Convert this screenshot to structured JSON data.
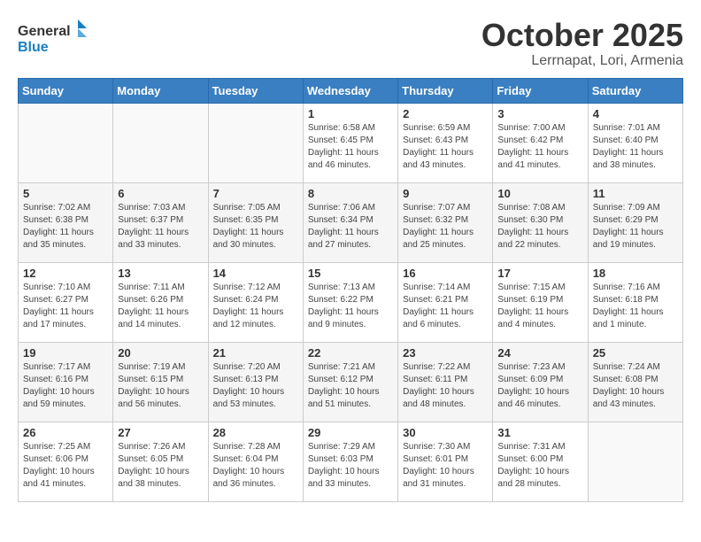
{
  "header": {
    "logo_line1": "General",
    "logo_line2": "Blue",
    "month": "October 2025",
    "location": "Lerrnapat, Lori, Armenia"
  },
  "days_of_week": [
    "Sunday",
    "Monday",
    "Tuesday",
    "Wednesday",
    "Thursday",
    "Friday",
    "Saturday"
  ],
  "weeks": [
    [
      {
        "day": "",
        "info": ""
      },
      {
        "day": "",
        "info": ""
      },
      {
        "day": "",
        "info": ""
      },
      {
        "day": "1",
        "info": "Sunrise: 6:58 AM\nSunset: 6:45 PM\nDaylight: 11 hours\nand 46 minutes."
      },
      {
        "day": "2",
        "info": "Sunrise: 6:59 AM\nSunset: 6:43 PM\nDaylight: 11 hours\nand 43 minutes."
      },
      {
        "day": "3",
        "info": "Sunrise: 7:00 AM\nSunset: 6:42 PM\nDaylight: 11 hours\nand 41 minutes."
      },
      {
        "day": "4",
        "info": "Sunrise: 7:01 AM\nSunset: 6:40 PM\nDaylight: 11 hours\nand 38 minutes."
      }
    ],
    [
      {
        "day": "5",
        "info": "Sunrise: 7:02 AM\nSunset: 6:38 PM\nDaylight: 11 hours\nand 35 minutes."
      },
      {
        "day": "6",
        "info": "Sunrise: 7:03 AM\nSunset: 6:37 PM\nDaylight: 11 hours\nand 33 minutes."
      },
      {
        "day": "7",
        "info": "Sunrise: 7:05 AM\nSunset: 6:35 PM\nDaylight: 11 hours\nand 30 minutes."
      },
      {
        "day": "8",
        "info": "Sunrise: 7:06 AM\nSunset: 6:34 PM\nDaylight: 11 hours\nand 27 minutes."
      },
      {
        "day": "9",
        "info": "Sunrise: 7:07 AM\nSunset: 6:32 PM\nDaylight: 11 hours\nand 25 minutes."
      },
      {
        "day": "10",
        "info": "Sunrise: 7:08 AM\nSunset: 6:30 PM\nDaylight: 11 hours\nand 22 minutes."
      },
      {
        "day": "11",
        "info": "Sunrise: 7:09 AM\nSunset: 6:29 PM\nDaylight: 11 hours\nand 19 minutes."
      }
    ],
    [
      {
        "day": "12",
        "info": "Sunrise: 7:10 AM\nSunset: 6:27 PM\nDaylight: 11 hours\nand 17 minutes."
      },
      {
        "day": "13",
        "info": "Sunrise: 7:11 AM\nSunset: 6:26 PM\nDaylight: 11 hours\nand 14 minutes."
      },
      {
        "day": "14",
        "info": "Sunrise: 7:12 AM\nSunset: 6:24 PM\nDaylight: 11 hours\nand 12 minutes."
      },
      {
        "day": "15",
        "info": "Sunrise: 7:13 AM\nSunset: 6:22 PM\nDaylight: 11 hours\nand 9 minutes."
      },
      {
        "day": "16",
        "info": "Sunrise: 7:14 AM\nSunset: 6:21 PM\nDaylight: 11 hours\nand 6 minutes."
      },
      {
        "day": "17",
        "info": "Sunrise: 7:15 AM\nSunset: 6:19 PM\nDaylight: 11 hours\nand 4 minutes."
      },
      {
        "day": "18",
        "info": "Sunrise: 7:16 AM\nSunset: 6:18 PM\nDaylight: 11 hours\nand 1 minute."
      }
    ],
    [
      {
        "day": "19",
        "info": "Sunrise: 7:17 AM\nSunset: 6:16 PM\nDaylight: 10 hours\nand 59 minutes."
      },
      {
        "day": "20",
        "info": "Sunrise: 7:19 AM\nSunset: 6:15 PM\nDaylight: 10 hours\nand 56 minutes."
      },
      {
        "day": "21",
        "info": "Sunrise: 7:20 AM\nSunset: 6:13 PM\nDaylight: 10 hours\nand 53 minutes."
      },
      {
        "day": "22",
        "info": "Sunrise: 7:21 AM\nSunset: 6:12 PM\nDaylight: 10 hours\nand 51 minutes."
      },
      {
        "day": "23",
        "info": "Sunrise: 7:22 AM\nSunset: 6:11 PM\nDaylight: 10 hours\nand 48 minutes."
      },
      {
        "day": "24",
        "info": "Sunrise: 7:23 AM\nSunset: 6:09 PM\nDaylight: 10 hours\nand 46 minutes."
      },
      {
        "day": "25",
        "info": "Sunrise: 7:24 AM\nSunset: 6:08 PM\nDaylight: 10 hours\nand 43 minutes."
      }
    ],
    [
      {
        "day": "26",
        "info": "Sunrise: 7:25 AM\nSunset: 6:06 PM\nDaylight: 10 hours\nand 41 minutes."
      },
      {
        "day": "27",
        "info": "Sunrise: 7:26 AM\nSunset: 6:05 PM\nDaylight: 10 hours\nand 38 minutes."
      },
      {
        "day": "28",
        "info": "Sunrise: 7:28 AM\nSunset: 6:04 PM\nDaylight: 10 hours\nand 36 minutes."
      },
      {
        "day": "29",
        "info": "Sunrise: 7:29 AM\nSunset: 6:03 PM\nDaylight: 10 hours\nand 33 minutes."
      },
      {
        "day": "30",
        "info": "Sunrise: 7:30 AM\nSunset: 6:01 PM\nDaylight: 10 hours\nand 31 minutes."
      },
      {
        "day": "31",
        "info": "Sunrise: 7:31 AM\nSunset: 6:00 PM\nDaylight: 10 hours\nand 28 minutes."
      },
      {
        "day": "",
        "info": ""
      }
    ]
  ]
}
